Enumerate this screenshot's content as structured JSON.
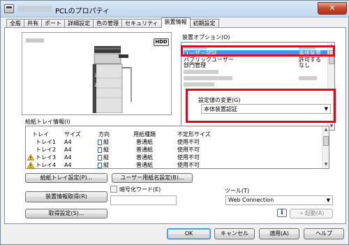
{
  "window": {
    "title_suffix": "PCLのプロパティ",
    "close_glyph": "✕"
  },
  "tabs": [
    "全般",
    "共有",
    "ポート",
    "詳細設定",
    "色の管理",
    "セキュリティ",
    "装置情報",
    "初期設定"
  ],
  "device": {
    "hdd_label": "HDD"
  },
  "options": {
    "label": "装置オプション(O)",
    "rows": [
      {
        "name": "",
        "value": ""
      },
      {
        "name": "ユーザー認証",
        "value": "本体装置"
      },
      {
        "name": "パブリックユーザー",
        "value": "許可する"
      },
      {
        "name": "部門管理",
        "value": "なし"
      }
    ]
  },
  "setting_change": {
    "label": "設定値の変更(G)",
    "value": "本体装置認証"
  },
  "tray": {
    "label": "給紙トレイ情報(I)",
    "headers": [
      "トレイ",
      "サイズ",
      "方向",
      "用紙種類",
      "不定形サイズ"
    ],
    "rows": [
      {
        "tray": "トレイ1",
        "size": "A4",
        "dir": "縦",
        "paper": "普通紙",
        "custom": "使用不可"
      },
      {
        "tray": "トレイ2",
        "size": "A4",
        "dir": "縦",
        "paper": "普通紙",
        "custom": "使用不可"
      },
      {
        "tray": "トレイ3",
        "size": "A4",
        "dir": "縦",
        "paper": "普通紙",
        "custom": "使用不可"
      },
      {
        "tray": "トレイ4",
        "size": "A4",
        "dir": "縦",
        "paper": "普通紙",
        "custom": "使用不可"
      }
    ]
  },
  "buttons": {
    "tray_settings": "給紙トレイ設定(P)...",
    "user_paper": "ユーザー用紙名設定(B)...",
    "get_device_info": "装置情報取得(R)",
    "get_settings": "取得設定(S)...",
    "launch": "起動(A)",
    "ok": "OK",
    "cancel": "キャンセル",
    "apply": "適用(A)",
    "help": "ヘルプ"
  },
  "encryption": {
    "label": "暗号化ワード(E)"
  },
  "tool": {
    "label": "ツール(T)",
    "value": "Web Connection"
  },
  "colors": {
    "selection": "#3399ff",
    "highlight": "#e8001c"
  }
}
